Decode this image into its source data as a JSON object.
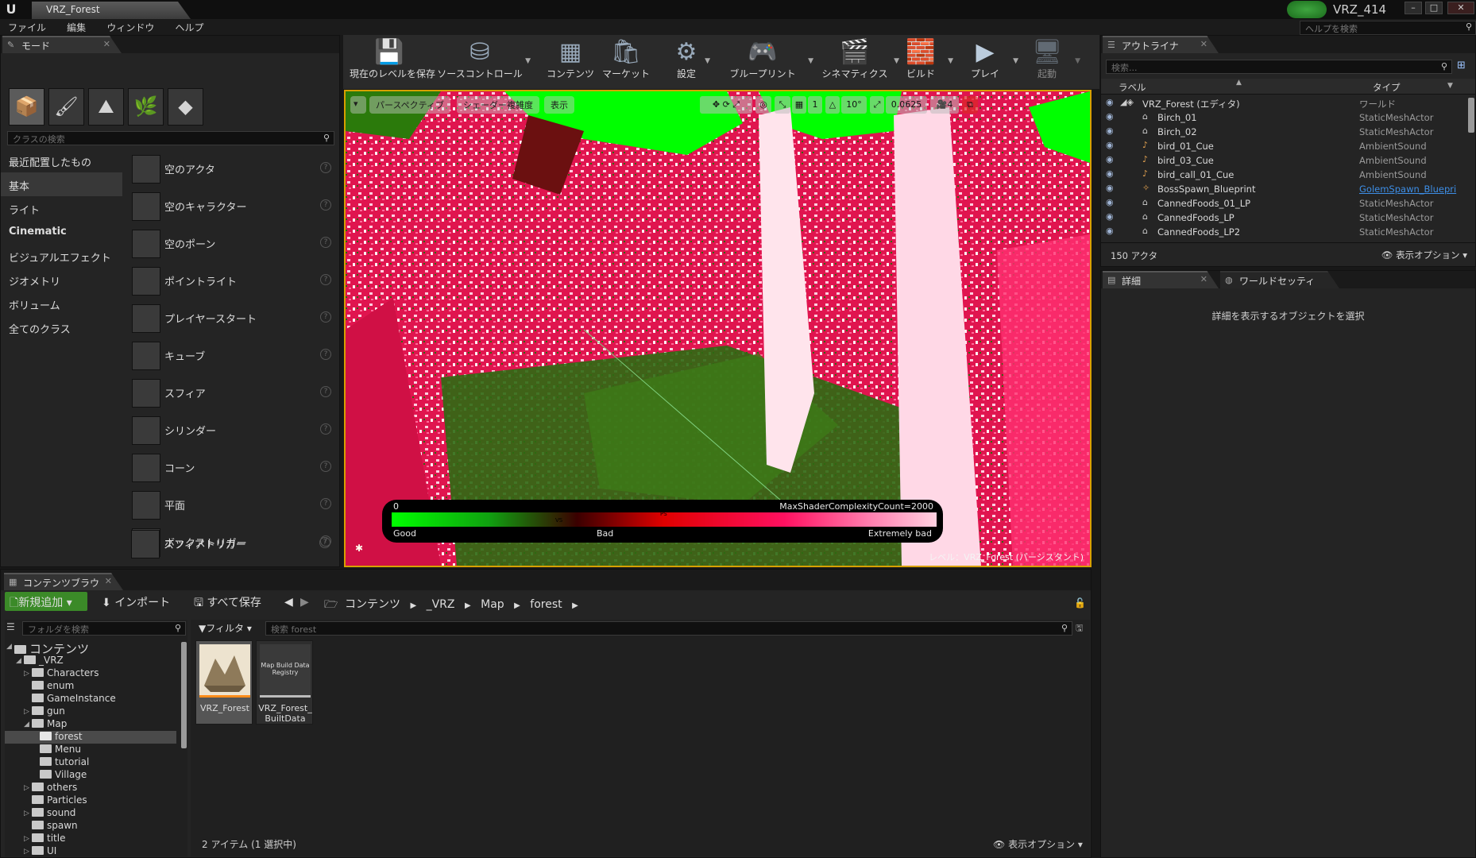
{
  "window": {
    "doc_tab": "VRZ_Forest",
    "project_name": "VRZ_414",
    "help_search_placeholder": "ヘルプを検索",
    "logo": "U"
  },
  "menu": [
    "ファイル",
    "編集",
    "ウィンドウ",
    "ヘルプ"
  ],
  "modes_panel": {
    "tab_label": "モード",
    "mode_icons": [
      "place-mode-icon",
      "paint-mode-icon",
      "landscape-mode-icon",
      "foliage-mode-icon",
      "geometry-mode-icon"
    ],
    "search_placeholder": "クラスの検索",
    "categories": [
      "最近配置したもの",
      "基本",
      "ライト",
      "Cinematic",
      "ビジュアルエフェクト",
      "ジオメトリ",
      "ボリューム",
      "全てのクラス"
    ],
    "selected_category": "基本",
    "items": [
      "空のアクタ",
      "空のキャラクター",
      "空のポーン",
      "ポイントライト",
      "プレイヤースタート",
      "キューブ",
      "スフィア",
      "シリンダー",
      "コーン",
      "平面",
      "ボックストリガー",
      "スフィアトリガー"
    ]
  },
  "toolbar": {
    "buttons": [
      {
        "label": "現在のレベルを保存",
        "icon": "save-icon"
      },
      {
        "label": "ソースコントロール",
        "icon": "source-control-icon"
      },
      {
        "label": "コンテンツ",
        "icon": "content-icon"
      },
      {
        "label": "マーケット",
        "icon": "marketplace-icon"
      },
      {
        "label": "設定",
        "icon": "settings-icon"
      },
      {
        "label": "ブループリント",
        "icon": "blueprint-icon"
      },
      {
        "label": "シネマティクス",
        "icon": "cinematics-icon"
      },
      {
        "label": "ビルド",
        "icon": "build-icon"
      },
      {
        "label": "プレイ",
        "icon": "play-icon"
      },
      {
        "label": "起動",
        "icon": "launch-icon"
      }
    ]
  },
  "viewport": {
    "perspective": "パースペクティブ",
    "view_mode": "シェーダー複雑度",
    "show": "表示",
    "grid_snap": "1",
    "rotation_snap": "10°",
    "scale_snap": "0.0625",
    "camera_speed": "4",
    "level_label": "レベル：VRZ_Forest (パーシスタント)",
    "legend": {
      "min": "0",
      "max": "MaxShaderComplexityCount=2000",
      "good": "Good",
      "bad": "Bad",
      "extremely_bad": "Extremely bad",
      "vs": "VS",
      "ps": "PS"
    },
    "colors": {
      "good": "#00ff00",
      "bad": "#e00000",
      "extremely_bad": "#ffd0e0",
      "selection_border": "#d7a000"
    }
  },
  "outliner": {
    "tab_label": "アウトライナ",
    "search_placeholder": "検索...",
    "col_label": "ラベル",
    "col_type": "タイプ",
    "rows": [
      {
        "name": "VRZ_Forest (エディタ)",
        "type": "ワールド"
      },
      {
        "name": "Birch_01",
        "type": "StaticMeshActor"
      },
      {
        "name": "Birch_02",
        "type": "StaticMeshActor"
      },
      {
        "name": "bird_01_Cue",
        "type": "AmbientSound"
      },
      {
        "name": "bird_03_Cue",
        "type": "AmbientSound"
      },
      {
        "name": "bird_call_01_Cue",
        "type": "AmbientSound"
      },
      {
        "name": "BossSpawn_Blueprint",
        "type": "GolemSpawn_Bluepri"
      },
      {
        "name": "CannedFoods_01_LP",
        "type": "StaticMeshActor"
      },
      {
        "name": "CannedFoods_LP",
        "type": "StaticMeshActor"
      },
      {
        "name": "CannedFoods_LP2",
        "type": "StaticMeshActor"
      }
    ],
    "actor_count": "150 アクタ",
    "view_options": "表示オプション"
  },
  "details": {
    "tab_label": "詳細",
    "world_settings_tab": "ワールドセッティン",
    "empty_message": "詳細を表示するオブジェクトを選択"
  },
  "content_browser": {
    "tab_label": "コンテンツブラウザ",
    "add_new": "新規追加",
    "import": "インポート",
    "save_all": "すべて保存",
    "breadcrumb": [
      "コンテンツ",
      "_VRZ",
      "Map",
      "forest"
    ],
    "folder_search_placeholder": "フォルダを検索",
    "filters": "フィルタ",
    "asset_search_placeholder": "検索 forest",
    "tree": [
      {
        "label": "コンテンツ",
        "depth": 0,
        "big": true
      },
      {
        "label": "_VRZ",
        "depth": 1
      },
      {
        "label": "Characters",
        "depth": 2
      },
      {
        "label": "enum",
        "depth": 2
      },
      {
        "label": "GameInstance",
        "depth": 2
      },
      {
        "label": "gun",
        "depth": 2
      },
      {
        "label": "Map",
        "depth": 2
      },
      {
        "label": "forest",
        "depth": 3,
        "selected": true
      },
      {
        "label": "Menu",
        "depth": 3
      },
      {
        "label": "tutorial",
        "depth": 3
      },
      {
        "label": "Village",
        "depth": 3
      },
      {
        "label": "others",
        "depth": 2
      },
      {
        "label": "Particles",
        "depth": 2
      },
      {
        "label": "sound",
        "depth": 2
      },
      {
        "label": "spawn",
        "depth": 2
      },
      {
        "label": "title",
        "depth": 2
      },
      {
        "label": "UI",
        "depth": 2
      }
    ],
    "assets": [
      {
        "name": "VRZ_Forest",
        "thumb_text": ""
      },
      {
        "name": "VRZ_Forest_BuiltData",
        "thumb_text": "Map Build Data Registry"
      }
    ],
    "status": "2 アイテム (1 選択中)",
    "view_options": "表示オプション"
  }
}
